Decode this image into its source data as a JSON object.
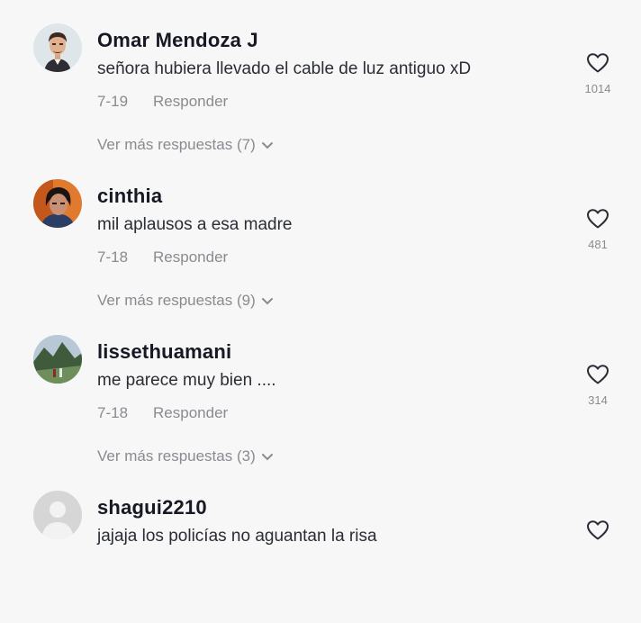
{
  "comments": [
    {
      "username": "Omar Mendoza J",
      "text": "señora hubiera llevado el cable de luz antiguo xD",
      "date": "7-19",
      "reply_label": "Responder",
      "more_replies": "Ver más respuestas (7)",
      "likes": "1014",
      "avatar": "bitmoji-avatar"
    },
    {
      "username": "cinthia",
      "text": "mil aplausos a esa madre",
      "date": "7-18",
      "reply_label": "Responder",
      "more_replies": "Ver más respuestas (9)",
      "likes": "481",
      "avatar": "photo-avatar"
    },
    {
      "username": "lissethuamani",
      "text": "me parece muy bien ....",
      "date": "7-18",
      "reply_label": "Responder",
      "more_replies": "Ver más respuestas (3)",
      "likes": "314",
      "avatar": "landscape-photo-avatar"
    },
    {
      "username": "shagui2210",
      "text": "jajaja los policías no aguantan la risa",
      "date": "",
      "reply_label": "",
      "more_replies": "",
      "likes": "",
      "avatar": "default-avatar"
    }
  ],
  "icons": {
    "like": "heart-outline-icon",
    "expand": "chevron-down-icon"
  },
  "colors": {
    "background": "#f7f7f7",
    "username": "#161823",
    "secondary_text": "#8a8b91"
  }
}
